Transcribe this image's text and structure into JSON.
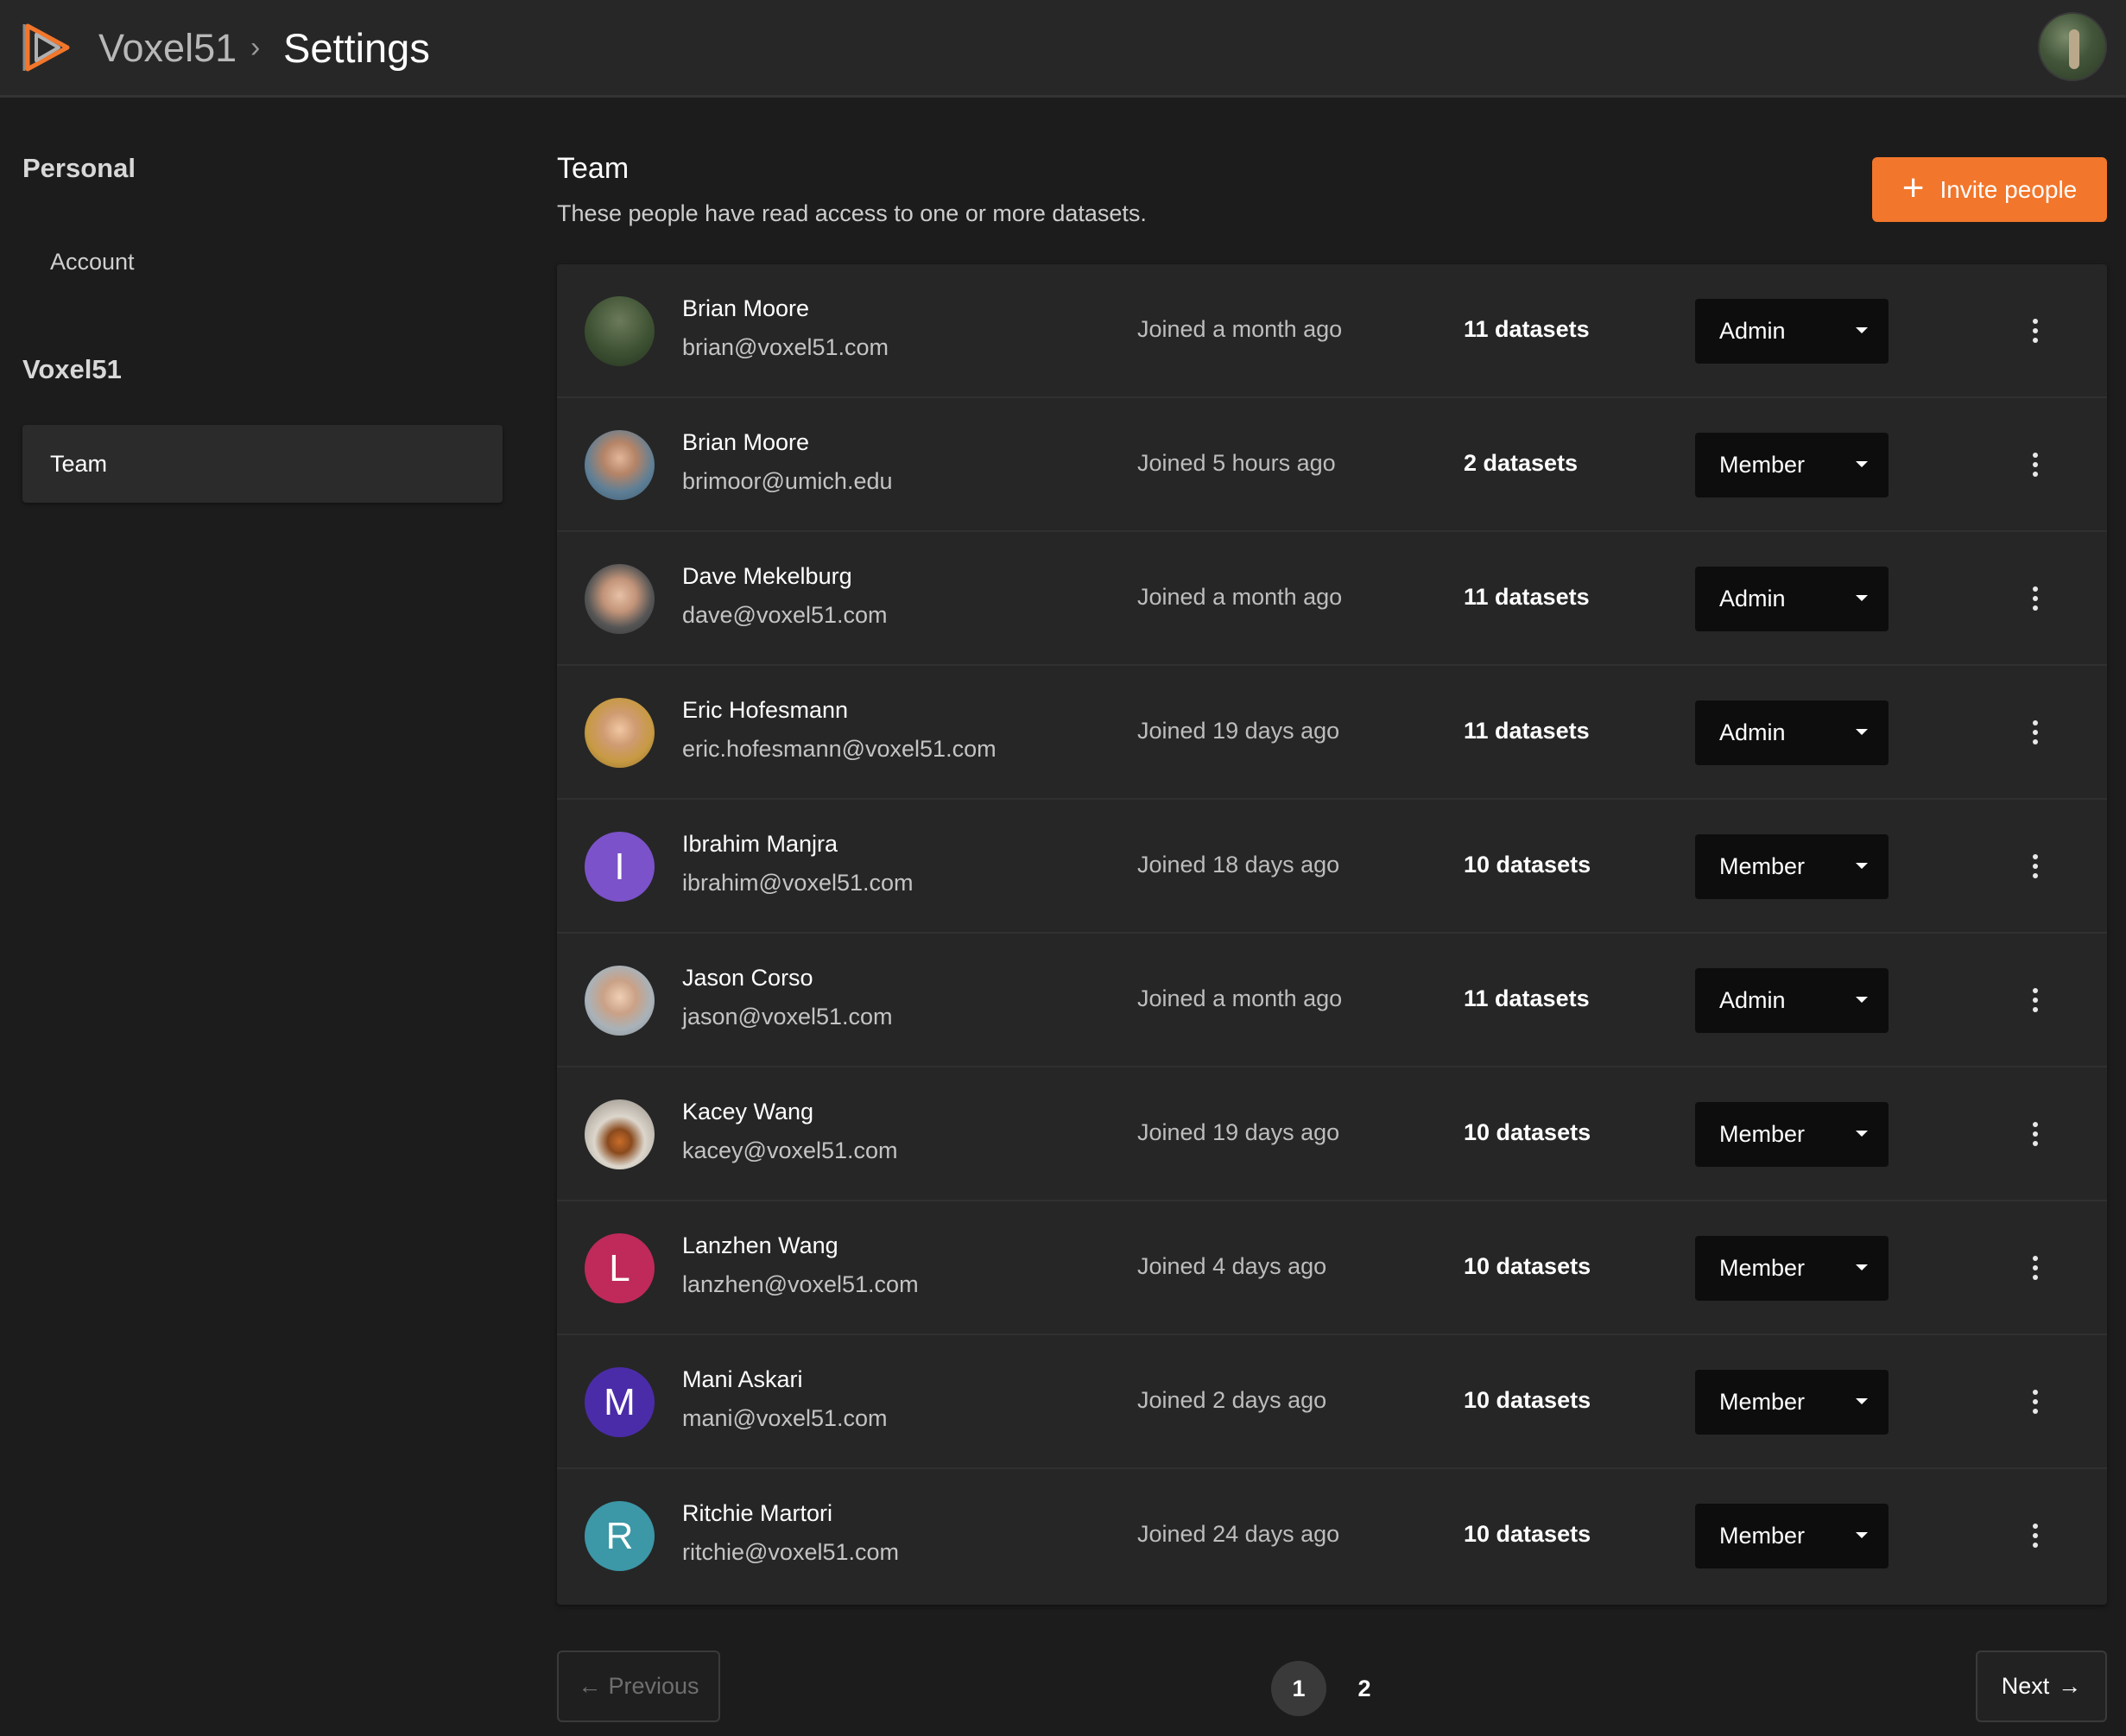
{
  "header": {
    "org_name": "Voxel51",
    "separator": "›",
    "page_title": "Settings"
  },
  "sidebar": {
    "sections": [
      {
        "title": "Personal",
        "items": [
          {
            "label": "Account",
            "active": false
          }
        ]
      },
      {
        "title": "Voxel51",
        "items": [
          {
            "label": "Team",
            "active": true
          }
        ]
      }
    ]
  },
  "main": {
    "title": "Team",
    "subtitle": "These people have read access to one or more datasets.",
    "invite_button": {
      "icon": "plus-icon",
      "label": "Invite people"
    }
  },
  "members": [
    {
      "name": "Brian Moore",
      "email": "brian@voxel51.com",
      "joined": "Joined a month ago",
      "datasets": "11 datasets",
      "role": "Admin",
      "avatar": "photo"
    },
    {
      "name": "Brian Moore",
      "email": "brimoor@umich.edu",
      "joined": "Joined 5 hours ago",
      "datasets": "2 datasets",
      "role": "Member",
      "avatar": "photo"
    },
    {
      "name": "Dave Mekelburg",
      "email": "dave@voxel51.com",
      "joined": "Joined a month ago",
      "datasets": "11 datasets",
      "role": "Admin",
      "avatar": "photo"
    },
    {
      "name": "Eric Hofesmann",
      "email": "eric.hofesmann@voxel51.com",
      "joined": "Joined 19 days ago",
      "datasets": "11 datasets",
      "role": "Admin",
      "avatar": "photo"
    },
    {
      "name": "Ibrahim Manjra",
      "email": "ibrahim@voxel51.com",
      "joined": "Joined 18 days ago",
      "datasets": "10 datasets",
      "role": "Member",
      "avatar": "I",
      "avatar_color": "#7b52c9"
    },
    {
      "name": "Jason Corso",
      "email": "jason@voxel51.com",
      "joined": "Joined a month ago",
      "datasets": "11 datasets",
      "role": "Admin",
      "avatar": "photo"
    },
    {
      "name": "Kacey Wang",
      "email": "kacey@voxel51.com",
      "joined": "Joined 19 days ago",
      "datasets": "10 datasets",
      "role": "Member",
      "avatar": "photo"
    },
    {
      "name": "Lanzhen Wang",
      "email": "lanzhen@voxel51.com",
      "joined": "Joined 4 days ago",
      "datasets": "10 datasets",
      "role": "Member",
      "avatar": "L",
      "avatar_color": "#bf2a5a"
    },
    {
      "name": "Mani Askari",
      "email": "mani@voxel51.com",
      "joined": "Joined 2 days ago",
      "datasets": "10 datasets",
      "role": "Member",
      "avatar": "M",
      "avatar_color": "#4a2ca8"
    },
    {
      "name": "Ritchie Martori",
      "email": "ritchie@voxel51.com",
      "joined": "Joined 24 days ago",
      "datasets": "10 datasets",
      "role": "Member",
      "avatar": "R",
      "avatar_color": "#3c97a6"
    }
  ],
  "pagination": {
    "previous_label": "Previous",
    "next_label": "Next",
    "pages": [
      "1",
      "2"
    ],
    "current_page": "1"
  },
  "colors": {
    "accent": "#f2762b",
    "background": "#1c1c1c",
    "panel": "#262626"
  }
}
